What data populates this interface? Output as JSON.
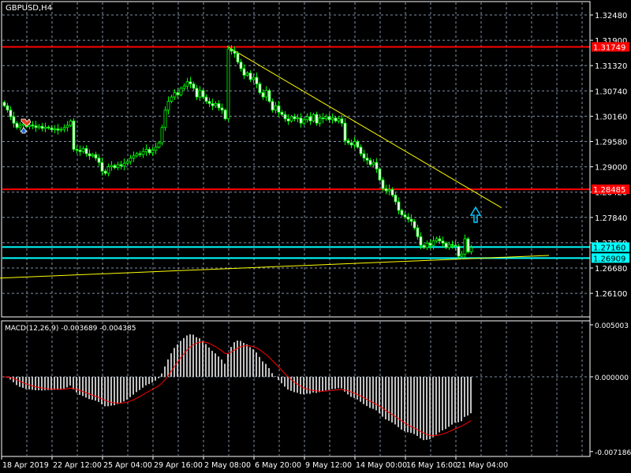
{
  "chart_title": "GBPUSD,H4",
  "macd_label": "MACD(12,26,9) -0.003689 -0.004385",
  "colors": {
    "background": "#000000",
    "candle": "#00ff00",
    "grid": "#7f8fa6",
    "resistance": "#ff0000",
    "support": "#00ffff",
    "trendline": "#ffff00",
    "signal": "#ff0000",
    "histogram": "#c0c0c0"
  },
  "price_axis": {
    "ticks": [
      "1.32480",
      "1.31900",
      "1.31320",
      "1.30740",
      "1.30160",
      "1.29580",
      "1.29000",
      "1.28420",
      "1.27840",
      "1.27260",
      "1.26680",
      "1.26100"
    ],
    "range": [
      1.2575,
      1.328
    ]
  },
  "price_levels": [
    {
      "label": "1.31749",
      "value": 1.31749,
      "kind": "resistance"
    },
    {
      "label": "1.28485",
      "value": 1.28485,
      "kind": "resistance"
    },
    {
      "label": "1.27160",
      "value": 1.2716,
      "kind": "support"
    },
    {
      "label": "1.26909",
      "value": 1.26909,
      "kind": "support"
    }
  ],
  "macd_axis": {
    "ticks": [
      "0.005003",
      "0.000000",
      "-0.007186"
    ],
    "max": 0.005003,
    "min": -0.007186
  },
  "time_axis": [
    "18 Apr 2019",
    "22 Apr 12:00",
    "25 Apr 04:00",
    "29 Apr 16:00",
    "2 May 08:00",
    "6 May 20:00",
    "9 May 12:00",
    "14 May 00:00",
    "16 May 16:00",
    "21 May 04:00"
  ],
  "chart_data": {
    "type": "candlestick",
    "symbol": "GBPUSD",
    "timeframe": "H4",
    "closes": [
      1.304,
      1.303,
      1.3015,
      1.3,
      1.299,
      1.2995,
      1.2998,
      1.2992,
      1.2996,
      1.2994,
      1.299,
      1.2993,
      1.2988,
      1.2991,
      1.2989,
      1.2985,
      1.2987,
      1.2984,
      1.2986,
      1.299,
      1.2995,
      1.3005,
      1.294,
      1.2938,
      1.2935,
      1.2942,
      1.293,
      1.2925,
      1.2928,
      1.292,
      1.291,
      1.289,
      1.2885,
      1.29,
      1.2903,
      1.2898,
      1.2905,
      1.2902,
      1.2908,
      1.2912,
      1.292,
      1.2925,
      1.293,
      1.2928,
      1.2935,
      1.294,
      1.2932,
      1.2938,
      1.2945,
      1.2955,
      1.299,
      1.303,
      1.305,
      1.306,
      1.307,
      1.3065,
      1.308,
      1.3085,
      1.3095,
      1.309,
      1.308,
      1.306,
      1.3075,
      1.306,
      1.305,
      1.3045,
      1.304,
      1.3045,
      1.3035,
      1.303,
      1.301,
      1.317,
      1.3165,
      1.316,
      1.314,
      1.3125,
      1.311,
      1.3115,
      1.31,
      1.3105,
      1.309,
      1.307,
      1.306,
      1.3075,
      1.305,
      1.303,
      1.304,
      1.3025,
      1.302,
      1.301,
      1.3005,
      1.3015,
      1.301,
      1.3012,
      1.3,
      1.3008,
      1.3015,
      1.3005,
      1.302,
      1.3,
      1.3012,
      1.301,
      1.3015,
      1.3008,
      1.3012,
      1.3005,
      1.301,
      1.3,
      1.296,
      1.2955,
      1.295,
      1.2958,
      1.2945,
      1.293,
      1.292,
      1.2915,
      1.2905,
      1.291,
      1.2895,
      1.287,
      1.285,
      1.2845,
      1.2848,
      1.2835,
      1.282,
      1.28,
      1.279,
      1.2785,
      1.278,
      1.2775,
      1.276,
      1.274,
      1.272,
      1.2715,
      1.2725,
      1.272,
      1.273,
      1.2735,
      1.273,
      1.2725,
      1.2715,
      1.2722,
      1.272,
      1.2718,
      1.2695,
      1.27,
      1.2735,
      1.2705,
      1.2715
    ],
    "macd": {
      "fast": 12,
      "slow": 26,
      "signal": 9,
      "last_macd": -0.003689,
      "last_signal": -0.004385
    },
    "trendlines": [
      {
        "name": "descending",
        "from": [
          1.3176,
          71
        ],
        "to": [
          1.2806,
          158
        ]
      },
      {
        "name": "ascending",
        "from": [
          1.2645,
          -1
        ],
        "to": [
          1.2697,
          173
        ]
      }
    ]
  }
}
